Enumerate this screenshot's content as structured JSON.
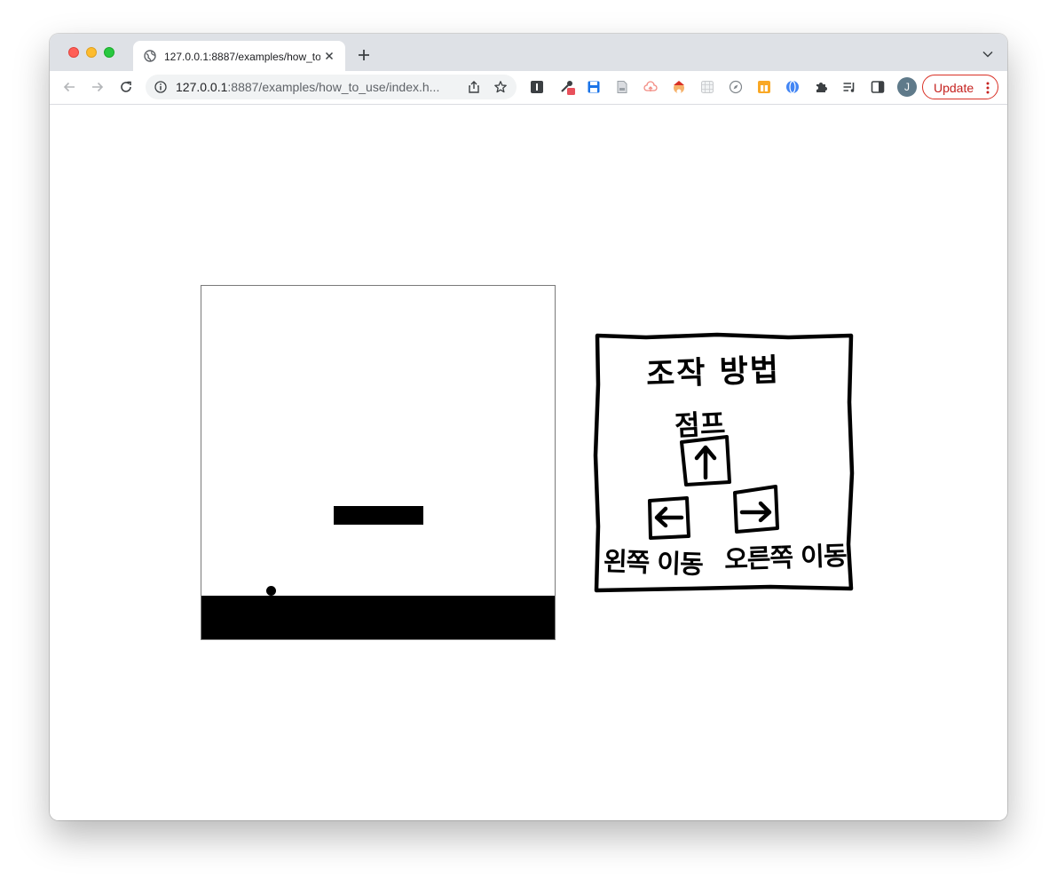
{
  "browser": {
    "tab_title": "127.0.0.1:8887/examples/how_to_use/index.html",
    "url_host": "127.0.0.1",
    "url_rest": ":8887/examples/how_to_use/index.h...",
    "avatar_initial": "J",
    "update_label": "Update",
    "extensions": [
      "instapaper-icon",
      "eyedropper-icon",
      "save-icon",
      "document-icon",
      "cloud-upload-icon",
      "santa-icon",
      "grid-icon",
      "compass-icon",
      "gift-icon",
      "globe-ext-icon",
      "puzzle-icon",
      "media-queue-icon",
      "sidepanel-icon"
    ]
  },
  "game": {
    "instructions": {
      "title": "조작 방법",
      "jump": "점프",
      "left": "왼쪽 이동",
      "right": "오른쪽 이동"
    }
  },
  "colors": {
    "update_accent": "#d93025",
    "game_fg": "#000000",
    "tab_bar": "#dee1e6"
  }
}
